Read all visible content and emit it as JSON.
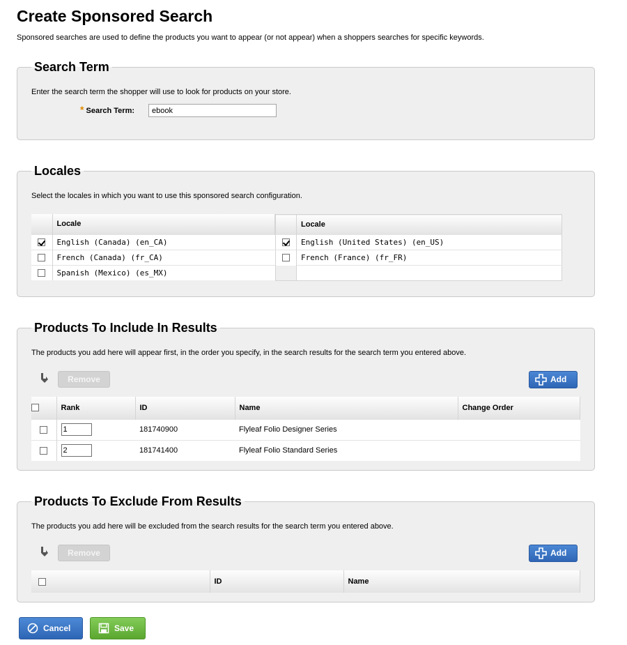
{
  "page": {
    "title": "Create Sponsored Search",
    "description": "Sponsored searches are used to define the products you want to appear (or not appear) when a shoppers searches for specific keywords."
  },
  "search_term": {
    "legend": "Search Term",
    "description": "Enter the search term the shopper will use to look for products on your store.",
    "required_mark": "*",
    "label": "Search Term:",
    "value": "ebook"
  },
  "locales": {
    "legend": "Locales",
    "description": "Select the locales in which you want to use this sponsored search configuration.",
    "column_header": "Locale",
    "left": [
      {
        "label": "English (Canada) (en_CA)",
        "checked": true
      },
      {
        "label": "French (Canada) (fr_CA)",
        "checked": false
      },
      {
        "label": "Spanish (Mexico) (es_MX)",
        "checked": false
      }
    ],
    "right": [
      {
        "label": "English (United States) (en_US)",
        "checked": true
      },
      {
        "label": "French (France) (fr_FR)",
        "checked": false
      }
    ]
  },
  "include": {
    "legend": "Products To Include In Results",
    "description": "The products you add here will appear first, in the order you specify, in the search results for the search term you entered above.",
    "remove_label": "Remove",
    "add_label": "Add",
    "columns": {
      "rank": "Rank",
      "id": "ID",
      "name": "Name",
      "change_order": "Change Order"
    },
    "rows": [
      {
        "rank": "1",
        "id": "181740900",
        "name": "Flyleaf Folio Designer Series"
      },
      {
        "rank": "2",
        "id": "181741400",
        "name": "Flyleaf Folio Standard Series"
      }
    ]
  },
  "exclude": {
    "legend": "Products To Exclude From Results",
    "description": "The products you add here will be excluded from the search results for the search term you entered above.",
    "remove_label": "Remove",
    "add_label": "Add",
    "columns": {
      "id": "ID",
      "name": "Name"
    }
  },
  "footer": {
    "cancel_label": "Cancel",
    "save_label": "Save"
  },
  "colors": {
    "primary_button": "#3a75c4",
    "save_button": "#6cba43",
    "required_asterisk": "#e08a00",
    "panel_background": "#efefef"
  }
}
